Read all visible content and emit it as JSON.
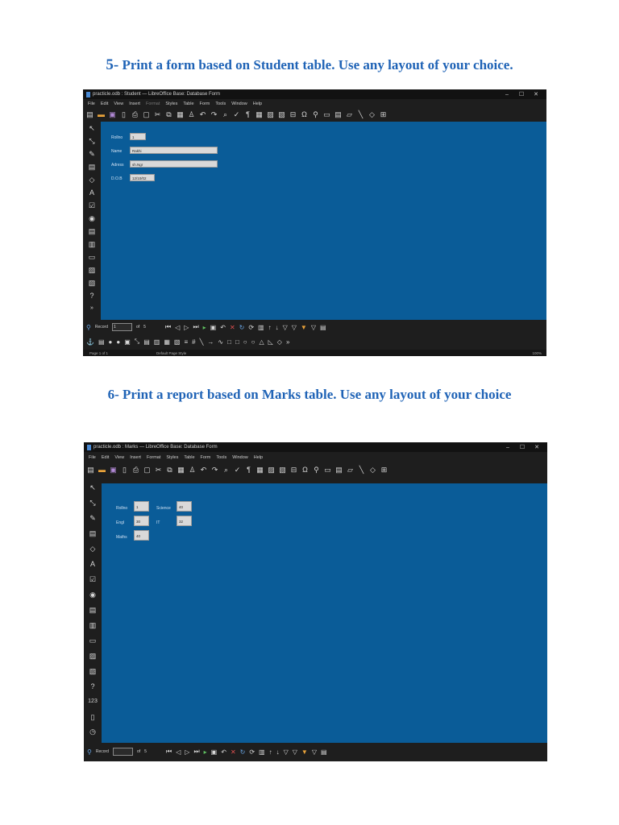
{
  "headings": [
    {
      "number": "5-",
      "text": " Print a form based on Student table. Use any layout of your choice."
    },
    {
      "number": "6-",
      "text": " Print a report based on Marks table. Use any layout of your choice"
    }
  ],
  "window_controls": {
    "minimize": "–",
    "maximize": "☐",
    "close": "✕"
  },
  "menu": [
    "File",
    "Edit",
    "View",
    "Insert",
    "Format",
    "Styles",
    "Table",
    "Form",
    "Tools",
    "Window",
    "Help"
  ],
  "screenshot1": {
    "title": "practicle.odb : Student — LibreOffice Base: Database Form",
    "fields": [
      {
        "label": "Rollno",
        "value": "1"
      },
      {
        "label": "Name",
        "value": "Rakhi"
      },
      {
        "label": "Adress",
        "value": "sh.Ngr"
      },
      {
        "label": "D.O.B",
        "value": "12/10/02"
      }
    ],
    "nav": {
      "record_label": "Record",
      "record_value": "1",
      "of_label": "of",
      "total": "5"
    },
    "status": {
      "page": "Page 1 of 1",
      "style": "Default Page Style",
      "zoom": "100%"
    }
  },
  "screenshot2": {
    "title": "practicle.odb : Marks — LibreOffice Base: Database Form",
    "fields": [
      {
        "label": "Rollno",
        "value": "1"
      },
      {
        "label": "Engl",
        "value": "30"
      },
      {
        "label": "Maths",
        "value": "40"
      },
      {
        "label": "Science",
        "value": "40"
      },
      {
        "label": "IT",
        "value": "32"
      }
    ],
    "nav": {
      "record_label": "Record",
      "record_value": "",
      "of_label": "of",
      "total": "5"
    }
  },
  "icons": {
    "document": "document-icon",
    "toolbar": [
      "new-icon",
      "open-icon",
      "save-icon",
      "pdf-icon",
      "print-icon",
      "preview-icon",
      "cut-icon",
      "copy-icon",
      "paste-icon",
      "clone-icon",
      "undo-icon",
      "redo-icon",
      "find-icon",
      "spellcheck-icon",
      "pilcrow-icon",
      "table-icon",
      "image-icon",
      "chart-icon",
      "textbox-icon",
      "special-char-icon",
      "hyperlink-icon",
      "note-icon",
      "header-icon",
      "line-icon",
      "shape-icon",
      "control-icon"
    ]
  }
}
